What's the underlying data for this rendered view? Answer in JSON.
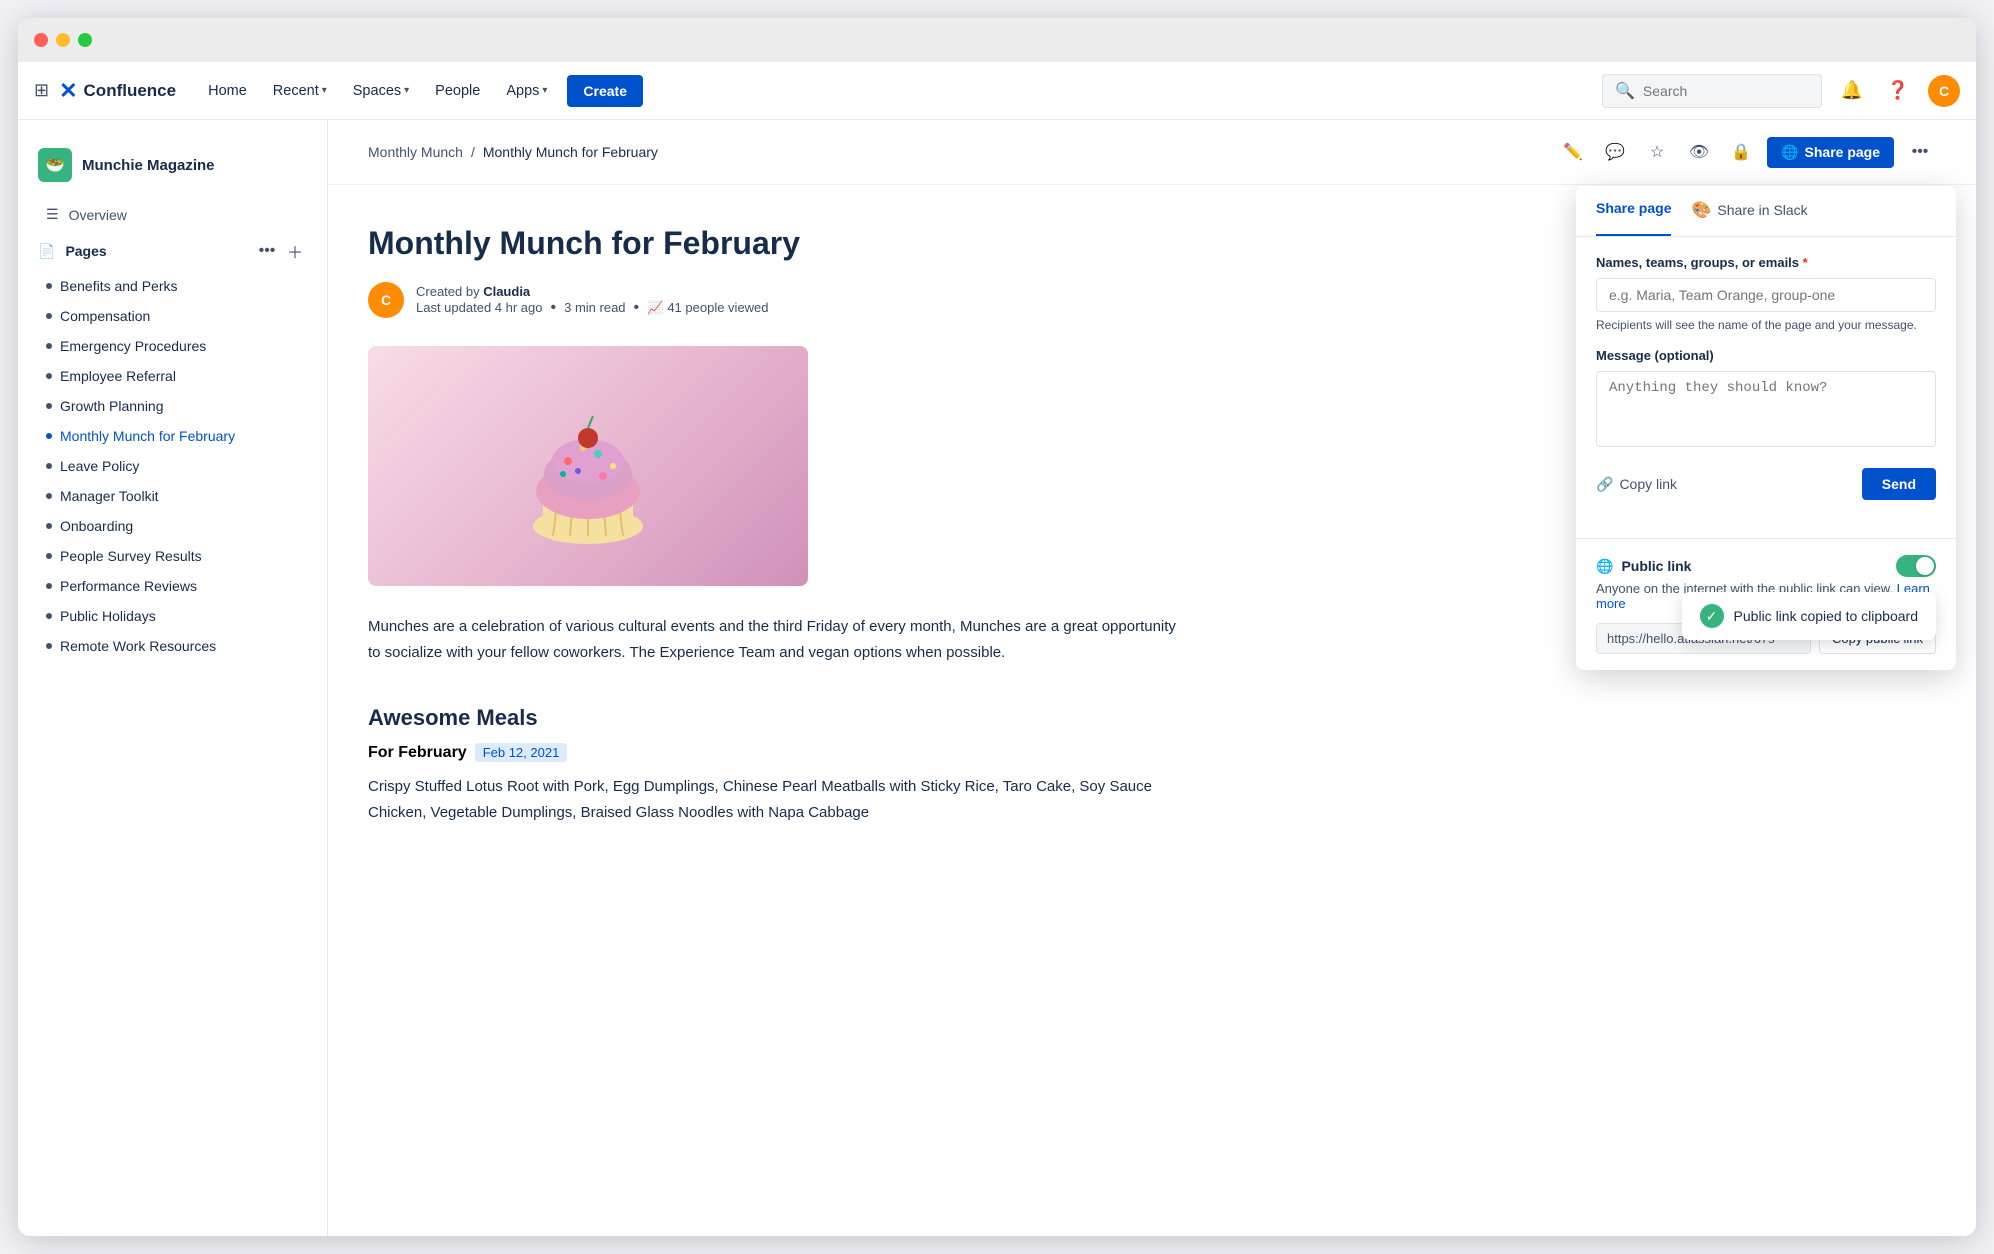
{
  "window": {
    "title": "Confluence"
  },
  "titlebar": {
    "traffic_lights": [
      "red",
      "yellow",
      "green"
    ]
  },
  "navbar": {
    "logo_text": "Confluence",
    "links": [
      {
        "id": "home",
        "label": "Home",
        "has_chevron": false
      },
      {
        "id": "recent",
        "label": "Recent",
        "has_chevron": true
      },
      {
        "id": "spaces",
        "label": "Spaces",
        "has_chevron": true
      },
      {
        "id": "people",
        "label": "People",
        "has_chevron": false
      },
      {
        "id": "apps",
        "label": "Apps",
        "has_chevron": true
      }
    ],
    "create_label": "Create",
    "search_placeholder": "Search",
    "avatar_text": "C"
  },
  "sidebar": {
    "space_name": "Munchie Magazine",
    "space_icon": "🥗",
    "overview_label": "Overview",
    "pages_label": "Pages",
    "pages": [
      {
        "id": "benefits",
        "label": "Benefits and Perks",
        "active": false
      },
      {
        "id": "compensation",
        "label": "Compensation",
        "active": false
      },
      {
        "id": "emergency",
        "label": "Emergency Procedures",
        "active": false
      },
      {
        "id": "employee-referral",
        "label": "Employee Referral",
        "active": false
      },
      {
        "id": "growth",
        "label": "Growth Planning",
        "active": false
      },
      {
        "id": "monthly-munch",
        "label": "Monthly Munch for February",
        "active": true
      },
      {
        "id": "leave",
        "label": "Leave Policy",
        "active": false
      },
      {
        "id": "manager",
        "label": "Manager Toolkit",
        "active": false
      },
      {
        "id": "onboarding",
        "label": "Onboarding",
        "active": false
      },
      {
        "id": "people-survey",
        "label": "People Survey Results",
        "active": false
      },
      {
        "id": "performance",
        "label": "Performance Reviews",
        "active": false
      },
      {
        "id": "public-holidays",
        "label": "Public Holidays",
        "active": false
      },
      {
        "id": "remote-work",
        "label": "Remote Work Resources",
        "active": false
      }
    ]
  },
  "breadcrumb": {
    "parent": "Monthly Munch",
    "current": "Monthly Munch for February"
  },
  "page": {
    "title": "Monthly Munch for February",
    "author": "Claudia",
    "last_updated": "Last updated 4 hr ago",
    "read_time": "3 min read",
    "views": "41 people viewed",
    "body": "Munches are a celebration of various cultural events and the third Friday of every month, Munches are a great opportunity to socialize with your fellow coworkers. The Experience Team and vegan options when possible.",
    "section_title": "Awesome Meals",
    "section_sub_label": "For February",
    "section_date": "Feb 12, 2021",
    "section_body": "Crispy Stuffed Lotus Root with Pork, Egg Dumplings, Chinese Pearl Meatballs with Sticky Rice, Taro Cake, Soy Sauce Chicken, Vegetable Dumplings, Braised Glass Noodles with Napa Cabbage"
  },
  "share_panel": {
    "tab_page": "Share page",
    "tab_slack": "Share in Slack",
    "field_label": "Names, teams, groups, or emails",
    "field_placeholder": "e.g. Maria, Team Orange, group-one",
    "field_hint": "Recipients will see the name of the page and your message.",
    "message_label": "Message (optional)",
    "message_placeholder": "Anything they should know?",
    "copy_link_label": "Copy link",
    "send_label": "Send",
    "public_link_title": "Public link",
    "public_link_desc": "Anyone on the internet with the public link can view.",
    "learn_more": "Learn more",
    "public_url": "https://hello.atlassian.net/67s",
    "copy_public_label": "Copy public link",
    "toggle_enabled": true
  },
  "toast": {
    "message": "Public link copied to clipboard"
  },
  "icons": {
    "grid": "⊞",
    "search": "🔍",
    "bell": "🔔",
    "help": "❓",
    "edit": "✏️",
    "comment": "💬",
    "star": "☆",
    "watch": "👁",
    "restrict": "🔒",
    "share": "🌐",
    "more": "•••",
    "overview": "☰",
    "pages": "📄",
    "link": "🔗",
    "globe": "🌐",
    "check": "✓"
  }
}
